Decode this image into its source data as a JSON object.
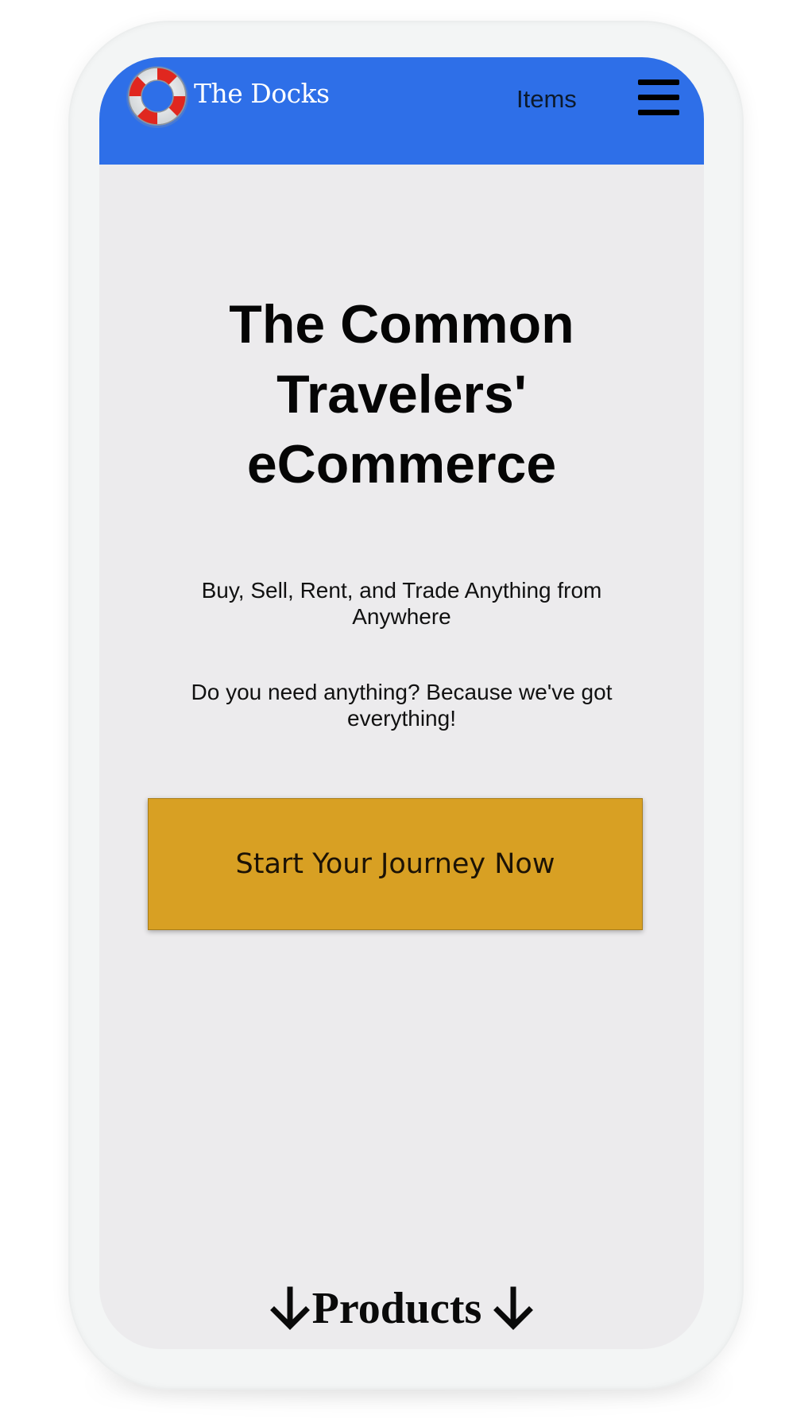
{
  "navbar": {
    "brand": "The Docks",
    "items_link": "Items",
    "logo_icon": "life-ring-icon",
    "menu_icon": "hamburger-menu-icon",
    "background_color": "#2e6fe8"
  },
  "hero": {
    "title": "The Common\nTravelers'\neCommerce",
    "subtitle": "Buy, Sell, Rent, and Trade Anything from\nAnywhere",
    "tagline": "Do you need anything? Because we've got\neverything!",
    "cta_label": "Start Your Journey Now",
    "cta_color": "#d8a023"
  },
  "products_section": {
    "heading": "Products",
    "arrow_icon": "arrow-down-icon"
  }
}
